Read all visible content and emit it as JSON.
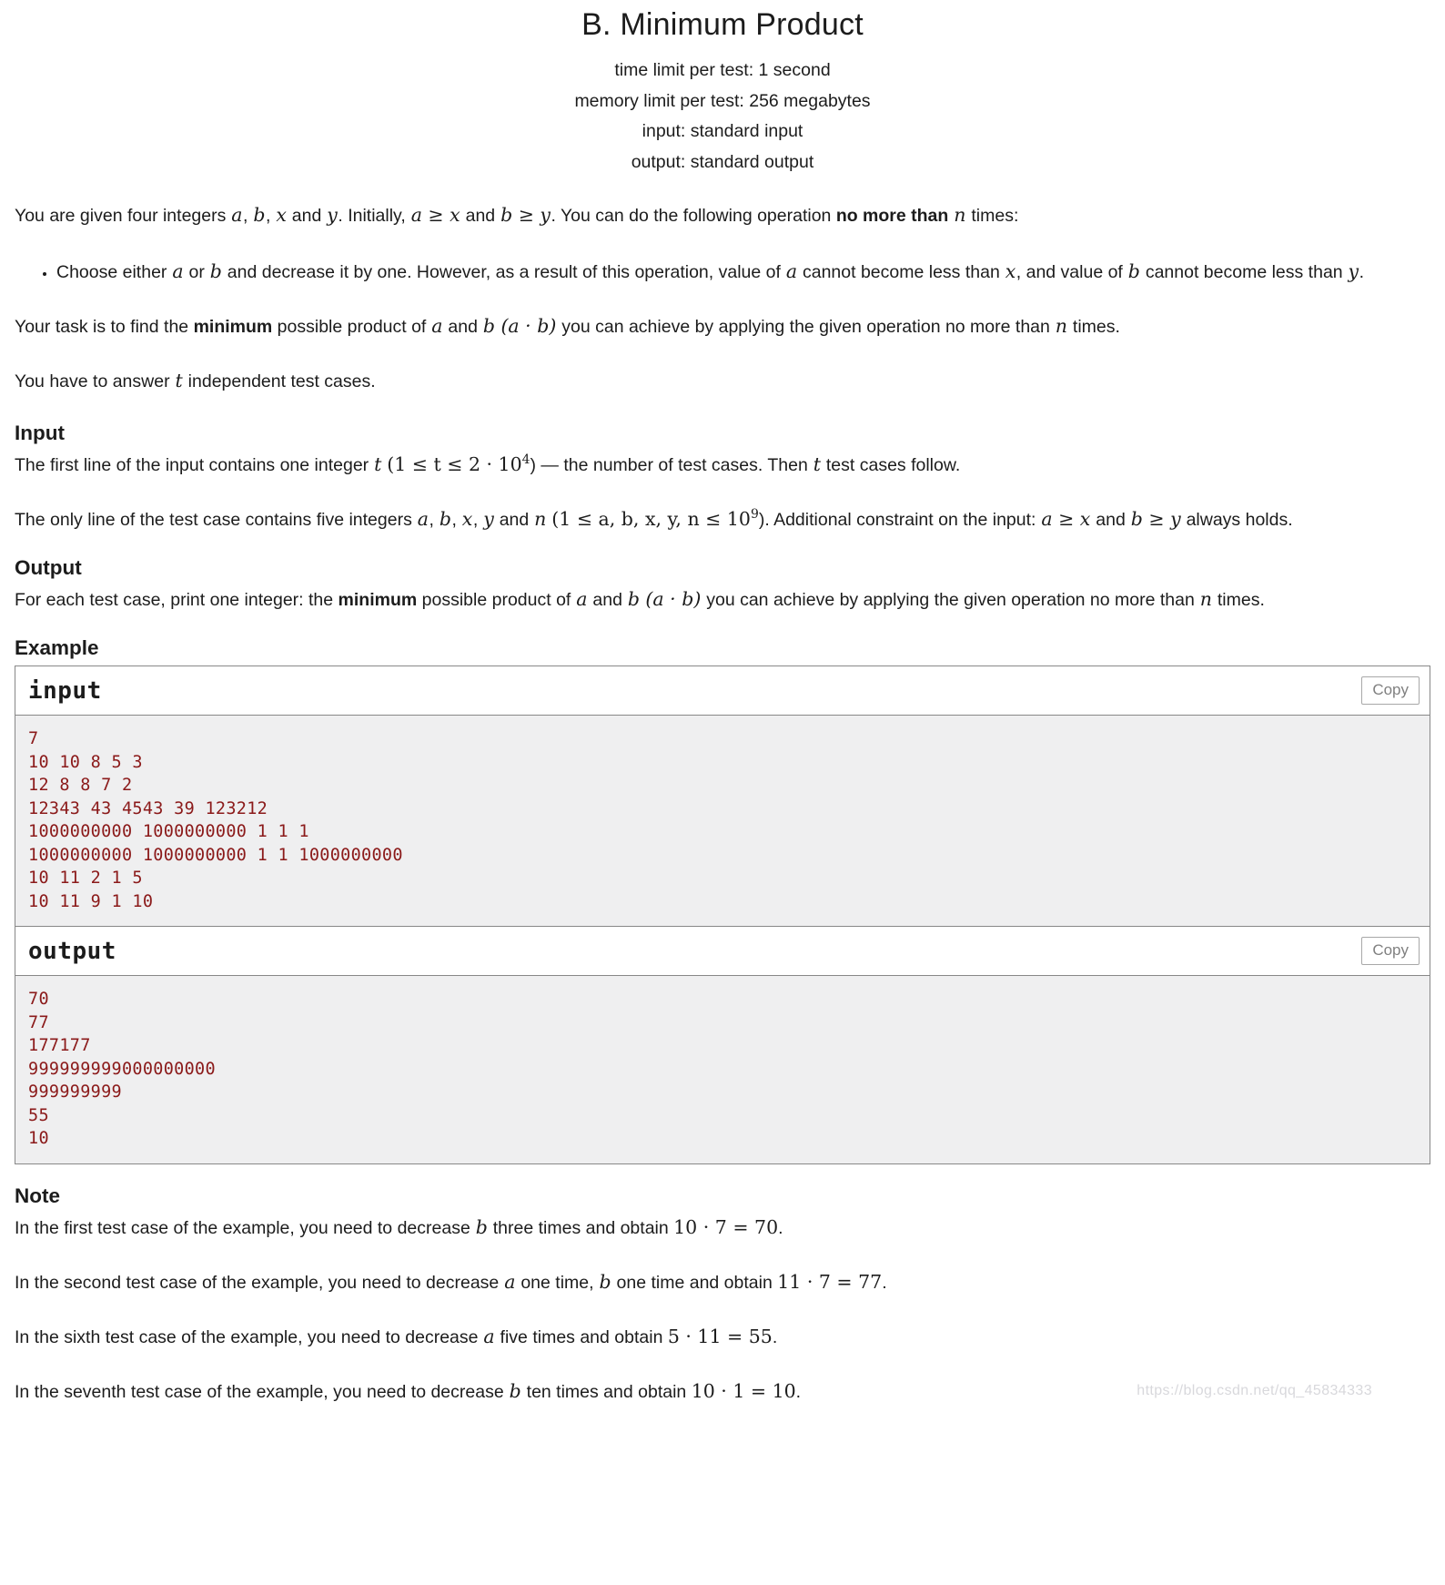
{
  "header": {
    "title": "B. Minimum Product",
    "time_limit": "time limit per test: 1 second",
    "memory_limit": "memory limit per test: 256 megabytes",
    "input_spec": "input: standard input",
    "output_spec": "output: standard output"
  },
  "statement": {
    "p1_part1": "You are given four integers ",
    "var_a": "a",
    "sep_comma": ", ",
    "var_b": "b",
    "sep_comma2": ", ",
    "var_x": "x",
    "p1_and": " and ",
    "var_y": "y",
    "p1_part2": ". Initially, ",
    "ineq_ax": "a ≥ x",
    "p1_part3": " and ",
    "ineq_by": "b ≥ y",
    "p1_part4": ". You can do the following operation ",
    "p1_bold": "no more than",
    "var_n": "n",
    "p1_part5": " times:",
    "bullet1_part1": "Choose either ",
    "bullet1_part2": " or ",
    "bullet1_part3": " and decrease it by one. However, as a result of this operation, value of ",
    "bullet1_part4": " cannot become less than ",
    "bullet1_part5": ", and value of ",
    "bullet1_part6": " cannot become less than ",
    "bullet1_part7": ".",
    "p2_part1": "Your task is to find the ",
    "p2_bold": "minimum",
    "p2_part2": " possible product of ",
    "p2_part3": " and ",
    "p2_product": "(a · b)",
    "p2_part4": " you can achieve by applying the given operation no more than ",
    "p2_part5": " times.",
    "p3_part1": "You have to answer ",
    "var_t": "t",
    "p3_part2": " independent test cases."
  },
  "input_section": {
    "heading": "Input",
    "p1_part1": "The first line of the input contains one integer ",
    "p1_constraint": "(1 ≤ t ≤ 2 · 10",
    "p1_exp": "4",
    "p1_part2": ") — the number of test cases. Then ",
    "p1_part3": " test cases follow.",
    "p2_part1": "The only line of the test case contains five integers ",
    "p2_constraint": "(1 ≤ a, b, x, y, n ≤ 10",
    "p2_exp": "9",
    "p2_part2": "). Additional constraint on the input: ",
    "p2_ineq1": "a ≥ x",
    "p2_part3": " and ",
    "p2_ineq2": "b ≥ y",
    "p2_part4": " always holds."
  },
  "output_section": {
    "heading": "Output",
    "p1_part1": "For each test case, print one integer: the ",
    "p1_bold": "minimum",
    "p1_part2": " possible product of ",
    "p1_part3": " and ",
    "p1_product": "(a · b)",
    "p1_part4": " you can achieve by applying the given operation no more than ",
    "p1_part5": " times."
  },
  "example_section": {
    "heading": "Example",
    "input_label": "input",
    "output_label": "output",
    "copy_label": "Copy",
    "input_data": "7\n10 10 8 5 3\n12 8 8 7 2\n12343 43 4543 39 123212\n1000000000 1000000000 1 1 1\n1000000000 1000000000 1 1 1000000000\n10 11 2 1 5\n10 11 9 1 10",
    "output_data": "70\n77\n177177\n999999999000000000\n999999999\n55\n10"
  },
  "note_section": {
    "heading": "Note",
    "n1_part1": "In the first test case of the example, you need to decrease ",
    "n1_part2": " three times and obtain ",
    "n1_math": "10 · 7 = 70",
    "n1_part3": ".",
    "n2_part1": "In the second test case of the example, you need to decrease ",
    "n2_part2": " one time, ",
    "n2_part3": " one time and obtain ",
    "n2_math": "11 · 7 = 77",
    "n2_part4": ".",
    "n3_part1": "In the sixth test case of the example, you need to decrease ",
    "n3_part2": " five times and obtain ",
    "n3_math": "5 · 11 = 55",
    "n3_part3": ".",
    "n4_part1": "In the seventh test case of the example, you need to decrease ",
    "n4_part2": " ten times and obtain ",
    "n4_math": "10 · 1 = 10",
    "n4_part3": "."
  },
  "watermark": {
    "text": "https://blog.csdn.net/qq_45834333"
  },
  "colors": {
    "sample_text": "#8b1a1a",
    "sample_bg": "#efeff0",
    "border": "#888888"
  }
}
